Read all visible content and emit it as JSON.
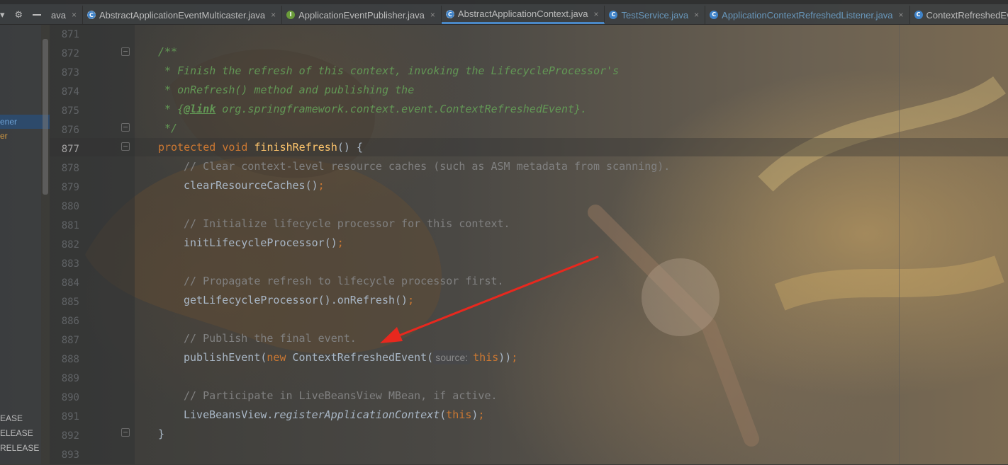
{
  "tabbar": {
    "tabs": [
      {
        "label": "ava",
        "icon": "none",
        "active": false,
        "blue": false
      },
      {
        "label": "AbstractApplicationEventMulticaster.java",
        "icon": "abstract-class-icon",
        "active": false,
        "blue": false
      },
      {
        "label": "ApplicationEventPublisher.java",
        "icon": "interface-icon",
        "active": false,
        "blue": false
      },
      {
        "label": "AbstractApplicationContext.java",
        "icon": "abstract-class-icon",
        "active": true,
        "blue": false
      },
      {
        "label": "TestService.java",
        "icon": "class-icon",
        "active": false,
        "blue": true
      },
      {
        "label": "ApplicationContextRefreshedListener.java",
        "icon": "class-icon",
        "active": false,
        "blue": true
      },
      {
        "label": "ContextRefreshedEve",
        "icon": "class-icon",
        "active": false,
        "blue": false
      }
    ],
    "close_glyph": "×",
    "settings_glyph": "⚙"
  },
  "sidebar": {
    "selected_item": "ener",
    "item2": "er",
    "release_items": [
      "EASE",
      "ELEASE",
      "RELEASE"
    ]
  },
  "editor": {
    "line_numbers": [
      "871",
      "872",
      "873",
      "874",
      "875",
      "876",
      "877",
      "878",
      "879",
      "880",
      "881",
      "882",
      "883",
      "884",
      "885",
      "886",
      "887",
      "888",
      "889",
      "890",
      "891",
      "892",
      "893"
    ],
    "current_line": "877",
    "doc": {
      "open": "/**",
      "line1": " * Finish the refresh of this context, invoking the LifecycleProcessor's",
      "line2": " * onRefresh() method and publishing the",
      "line3_prefix": " * {",
      "line3_tag": "@link",
      "line3_rest": " org.springframework.context.event.ContextRefreshedEvent}.",
      "close": " */"
    },
    "method": {
      "keyword_protected": "protected",
      "keyword_void": "void",
      "name": "finishRefresh",
      "signature_rest": "() {"
    },
    "comments": {
      "c1": "// Clear context-level resource caches (such as ASM metadata from scanning).",
      "c2": "// Initialize lifecycle processor for this context.",
      "c3": "// Propagate refresh to lifecycle processor first.",
      "c4": "// Publish the final event.",
      "c5": "// Participate in LiveBeansView MBean, if active."
    },
    "statements": {
      "s1": "clearResourceCaches",
      "s1_rest": "()",
      "s2": "initLifecycleProcessor",
      "s2_rest": "()",
      "s3": "getLifecycleProcessor().onRefresh",
      "s3_rest": "()",
      "s4_call": "publishEvent(",
      "s4_new": "new",
      "s4_class": " ContextRefreshedEvent(",
      "s4_hint": "source:",
      "s4_this": "this",
      "s4_end": "))",
      "s5_obj": "LiveBeansView.",
      "s5_method": "registerApplicationContext",
      "s5_open": "(",
      "s5_this": "this",
      "s5_close": ")",
      "semicolon": ";"
    },
    "closing_brace": "}"
  },
  "colors": {
    "keyword": "#cc7832",
    "method_decl": "#ffc66d",
    "comment": "#808080",
    "javadoc": "#629755",
    "annotation_arrow": "#e8281e"
  }
}
